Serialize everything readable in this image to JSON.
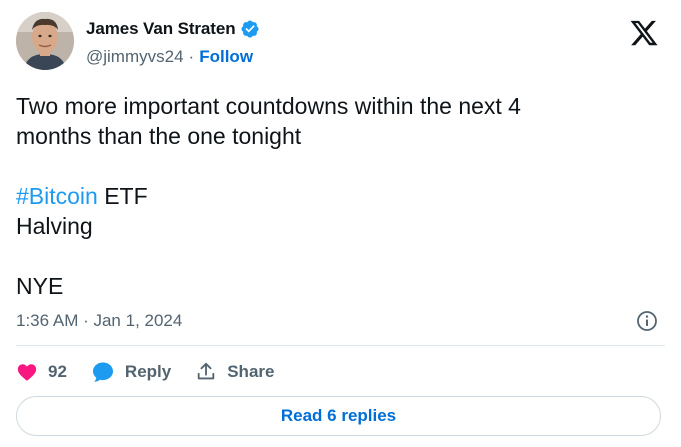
{
  "author": {
    "name": "James Van Straten",
    "handle": "@jimmyvs24",
    "separator": "·",
    "follow_label": "Follow"
  },
  "tweet": {
    "line1": "Two more important countdowns within the next 4",
    "line2": "months than the one tonight",
    "line3": "",
    "hashtag": "#Bitcoin",
    "line4_rest": " ETF",
    "line5": "Halving",
    "line6": "",
    "line7": "NYE"
  },
  "meta": {
    "timestamp": "1:36 AM · Jan 1, 2024"
  },
  "actions": {
    "likes_count": "92",
    "reply_label": "Reply",
    "share_label": "Share"
  },
  "footer": {
    "read_replies_label": "Read 6 replies"
  },
  "colors": {
    "like": "#f91880",
    "reply": "#1d9bf0",
    "link": "#006fd6",
    "verified": "#1d9bf0"
  },
  "icons": [
    "verified-badge-icon",
    "x-logo-icon",
    "info-icon",
    "heart-icon",
    "reply-bubble-icon",
    "share-icon"
  ]
}
